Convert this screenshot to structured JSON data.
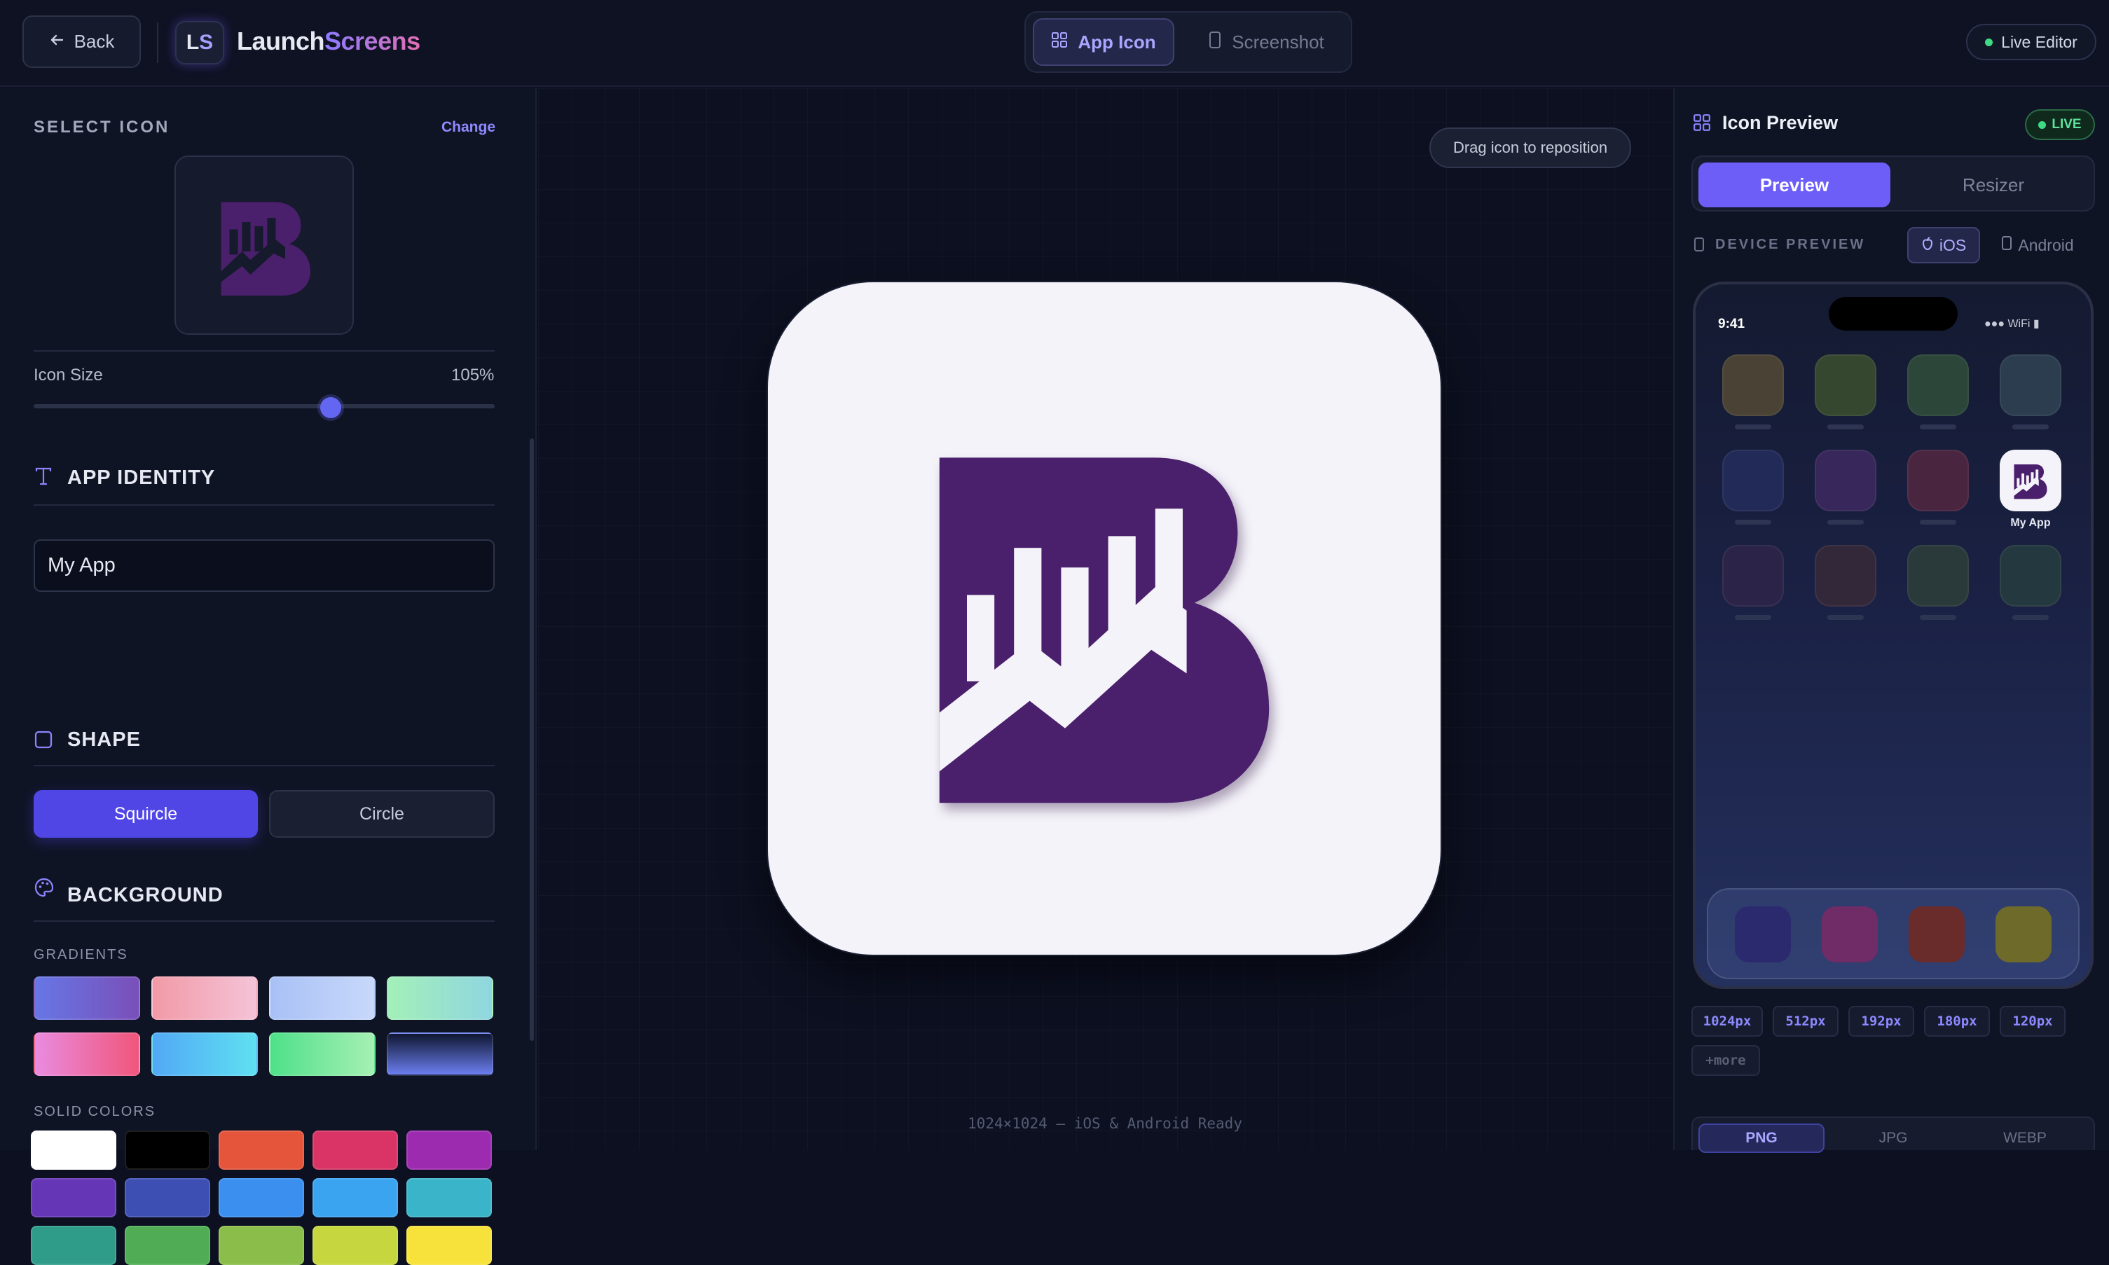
{
  "header": {
    "back_label": "Back",
    "logo_text_l": "L",
    "logo_text_s": "S",
    "brand_part1": "Launch",
    "brand_part2": "Screens",
    "tabs": [
      {
        "label": "App Icon",
        "active": true
      },
      {
        "label": "Screenshot",
        "active": false
      }
    ],
    "live_editor_label": "Live Editor"
  },
  "left_panel": {
    "select_icon_title": "SELECT ICON",
    "change_label": "Change",
    "icon_size_label": "Icon Size",
    "icon_size_value": "105%",
    "icon_size_fraction": 0.645,
    "app_identity_title": "APP IDENTITY",
    "app_name_value": "My App",
    "shape_title": "SHAPE",
    "shape_options": [
      "Squircle",
      "Circle"
    ],
    "shape_selected": "Squircle",
    "background_title": "BACKGROUND",
    "gradients_label": "GRADIENTS",
    "gradients": [
      [
        "#6677e6",
        "#7a4fb8"
      ],
      [
        "#f29aa6",
        "#f4c3d8"
      ],
      [
        "#a8c1f5",
        "#c8d8fb"
      ],
      [
        "#a3f0b8",
        "#8fd6e0"
      ],
      [
        "#e98be0",
        "#f0567a"
      ],
      [
        "#52a9f5",
        "#5fe0f2"
      ],
      [
        "#4fe08a",
        "#a6f0b4"
      ],
      [
        "#0f1631",
        "#6b7ff0"
      ]
    ],
    "solid_colors_label": "SOLID COLORS",
    "solid_colors": [
      "#ffffff",
      "#000000",
      "#e4553b",
      "#d93465",
      "#9c2bb0",
      "#6536b6",
      "#3e4fb4",
      "#3a8fef",
      "#3aa4f0",
      "#3ab4c8",
      "#2f9c89",
      "#50ad55",
      "#8bbd4a",
      "#c6d63f",
      "#f7e23c"
    ]
  },
  "canvas": {
    "drag_hint": "Drag icon to reposition",
    "footnote": "1024×1024 — iOS & Android Ready",
    "icon_background": "#f4f3f9",
    "brand_purple": "#4a1f6b"
  },
  "right_panel": {
    "title": "Icon Preview",
    "live_badge": "LIVE",
    "tabs": [
      "Preview",
      "Resizer"
    ],
    "device_preview_label": "DEVICE PREVIEW",
    "platforms": [
      "iOS",
      "Android"
    ],
    "platform_selected": "iOS",
    "phone": {
      "time": "9:41",
      "status": "●●● WiFi ▮",
      "app_label": "My App",
      "home_icon_colors": [
        "#4a4235",
        "#36472f",
        "#2c4639",
        "#2b3d4e",
        "#222a58",
        "#37275a",
        "#4a2540",
        null,
        "#2c2448",
        "#32283a",
        "#2a3a3b",
        "#24393f"
      ],
      "dock_colors": [
        "#2b2a6e",
        "#702c66",
        "#6a2b2b",
        "#6e6a2a"
      ]
    },
    "size_chips": [
      "1024px",
      "512px",
      "192px",
      "180px",
      "120px"
    ],
    "more_chip": "+more",
    "formats": [
      "PNG",
      "JPG",
      "WEBP"
    ],
    "format_selected": "PNG"
  }
}
